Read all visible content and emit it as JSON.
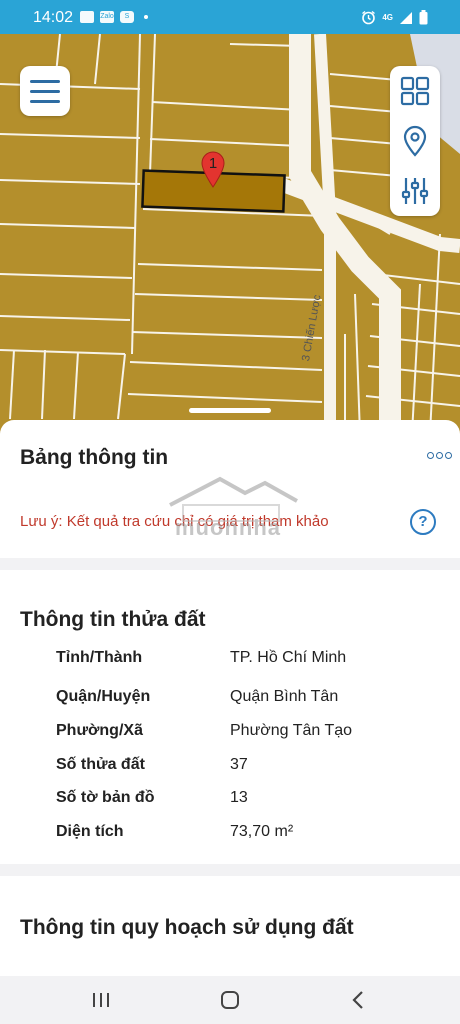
{
  "status_bar": {
    "time": "14:02",
    "notification_icons": [
      "image-icon",
      "zalo-icon",
      "s-app-icon"
    ],
    "network": "4G",
    "right_icons": [
      "alarm-icon",
      "signal-icon",
      "battery-icon"
    ]
  },
  "map": {
    "marker_label": "1",
    "street_label": "3 Chiến Lược",
    "colors": {
      "land": "#b48f2c",
      "selected": "#a57708",
      "road": "#f7f3ea",
      "marker": "#e3342f"
    }
  },
  "map_controls": {
    "menu": "menu-icon",
    "tools": [
      "grid-icon",
      "location-pin-icon",
      "filter-sliders-icon"
    ]
  },
  "panel": {
    "title": "Bảng thông tin",
    "note": "Lưu ý: Kết quả tra cứu chỉ có giá trị tham khảo",
    "help": "?"
  },
  "land_info": {
    "title": "Thông tin thửa đất",
    "rows": [
      {
        "label": "Tỉnh/Thành",
        "value": "TP. Hồ Chí Minh"
      },
      {
        "label": "Quận/Huyện",
        "value": "Quận Bình Tân"
      },
      {
        "label": "Phường/Xã",
        "value": "Phường Tân Tạo"
      },
      {
        "label": "Số thửa đất",
        "value": "37"
      },
      {
        "label": "Số tờ bản đồ",
        "value": "13"
      },
      {
        "label": "Diện tích",
        "value": "73,70 m²"
      }
    ]
  },
  "planning_info": {
    "title": "Thông tin quy hoạch sử dụng đất"
  },
  "watermark": {
    "text": "muonnha"
  },
  "nav_bar": {
    "items": [
      "recent-apps-icon",
      "home-icon",
      "back-icon"
    ]
  },
  "accent_color": "#2d6ca3"
}
